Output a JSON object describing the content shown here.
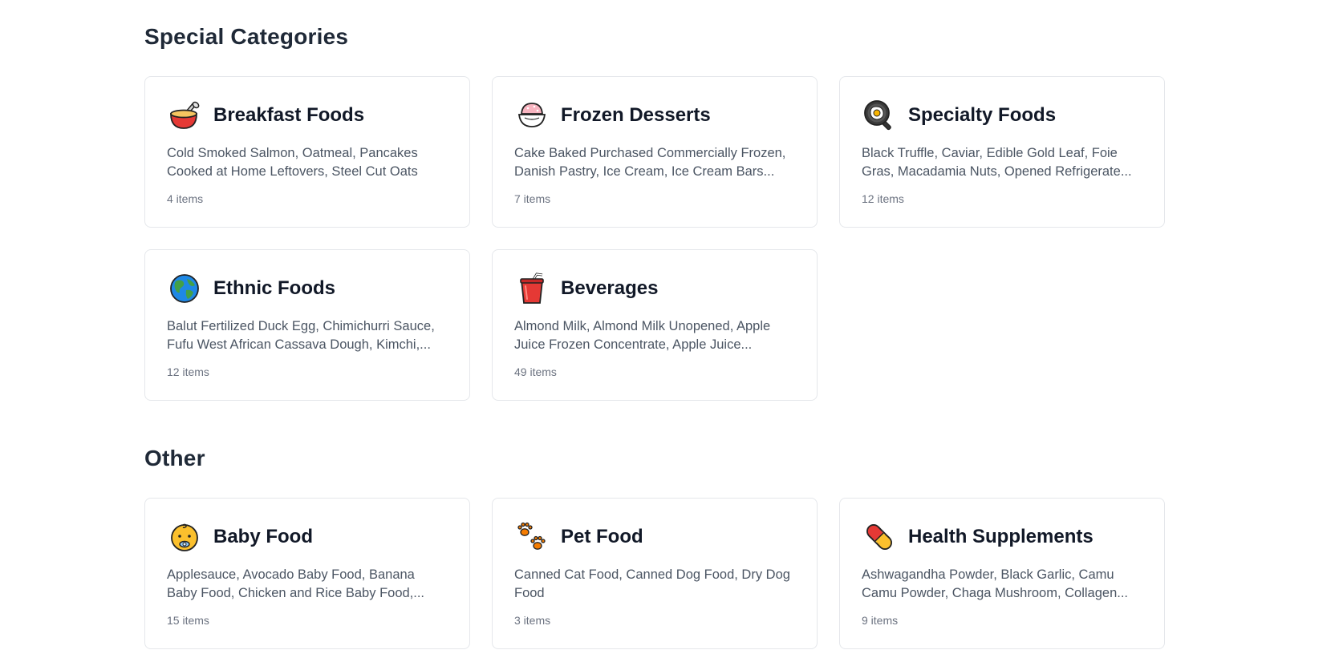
{
  "sections": [
    {
      "title": "Special Categories",
      "cards": [
        {
          "icon": "bowl-with-spoon-icon",
          "title": "Breakfast Foods",
          "desc": "Cold Smoked Salmon, Oatmeal, Pancakes Cooked at Home Leftovers, Steel Cut Oats",
          "count": "4 items"
        },
        {
          "icon": "shaved-ice-icon",
          "title": "Frozen Desserts",
          "desc": "Cake Baked Purchased Commercially Frozen, Danish Pastry, Ice Cream, Ice Cream Bars...",
          "count": "7 items"
        },
        {
          "icon": "frying-pan-egg-icon",
          "title": "Specialty Foods",
          "desc": "Black Truffle, Caviar, Edible Gold Leaf, Foie Gras, Macadamia Nuts, Opened Refrigerate...",
          "count": "12 items"
        },
        {
          "icon": "globe-icon",
          "title": "Ethnic Foods",
          "desc": "Balut Fertilized Duck Egg, Chimichurri Sauce, Fufu West African Cassava Dough, Kimchi,...",
          "count": "12 items"
        },
        {
          "icon": "cup-with-straw-icon",
          "title": "Beverages",
          "desc": "Almond Milk, Almond Milk Unopened, Apple Juice Frozen Concentrate, Apple Juice...",
          "count": "49 items"
        }
      ]
    },
    {
      "title": "Other",
      "cards": [
        {
          "icon": "baby-icon",
          "title": "Baby Food",
          "desc": "Applesauce, Avocado Baby Food, Banana Baby Food, Chicken and Rice Baby Food,...",
          "count": "15 items"
        },
        {
          "icon": "paw-prints-icon",
          "title": "Pet Food",
          "desc": "Canned Cat Food, Canned Dog Food, Dry Dog Food",
          "count": "3 items"
        },
        {
          "icon": "pill-icon",
          "title": "Health Supplements",
          "desc": "Ashwagandha Powder, Black Garlic, Camu Camu Powder, Chaga Mushroom, Collagen...",
          "count": "9 items"
        }
      ]
    }
  ]
}
